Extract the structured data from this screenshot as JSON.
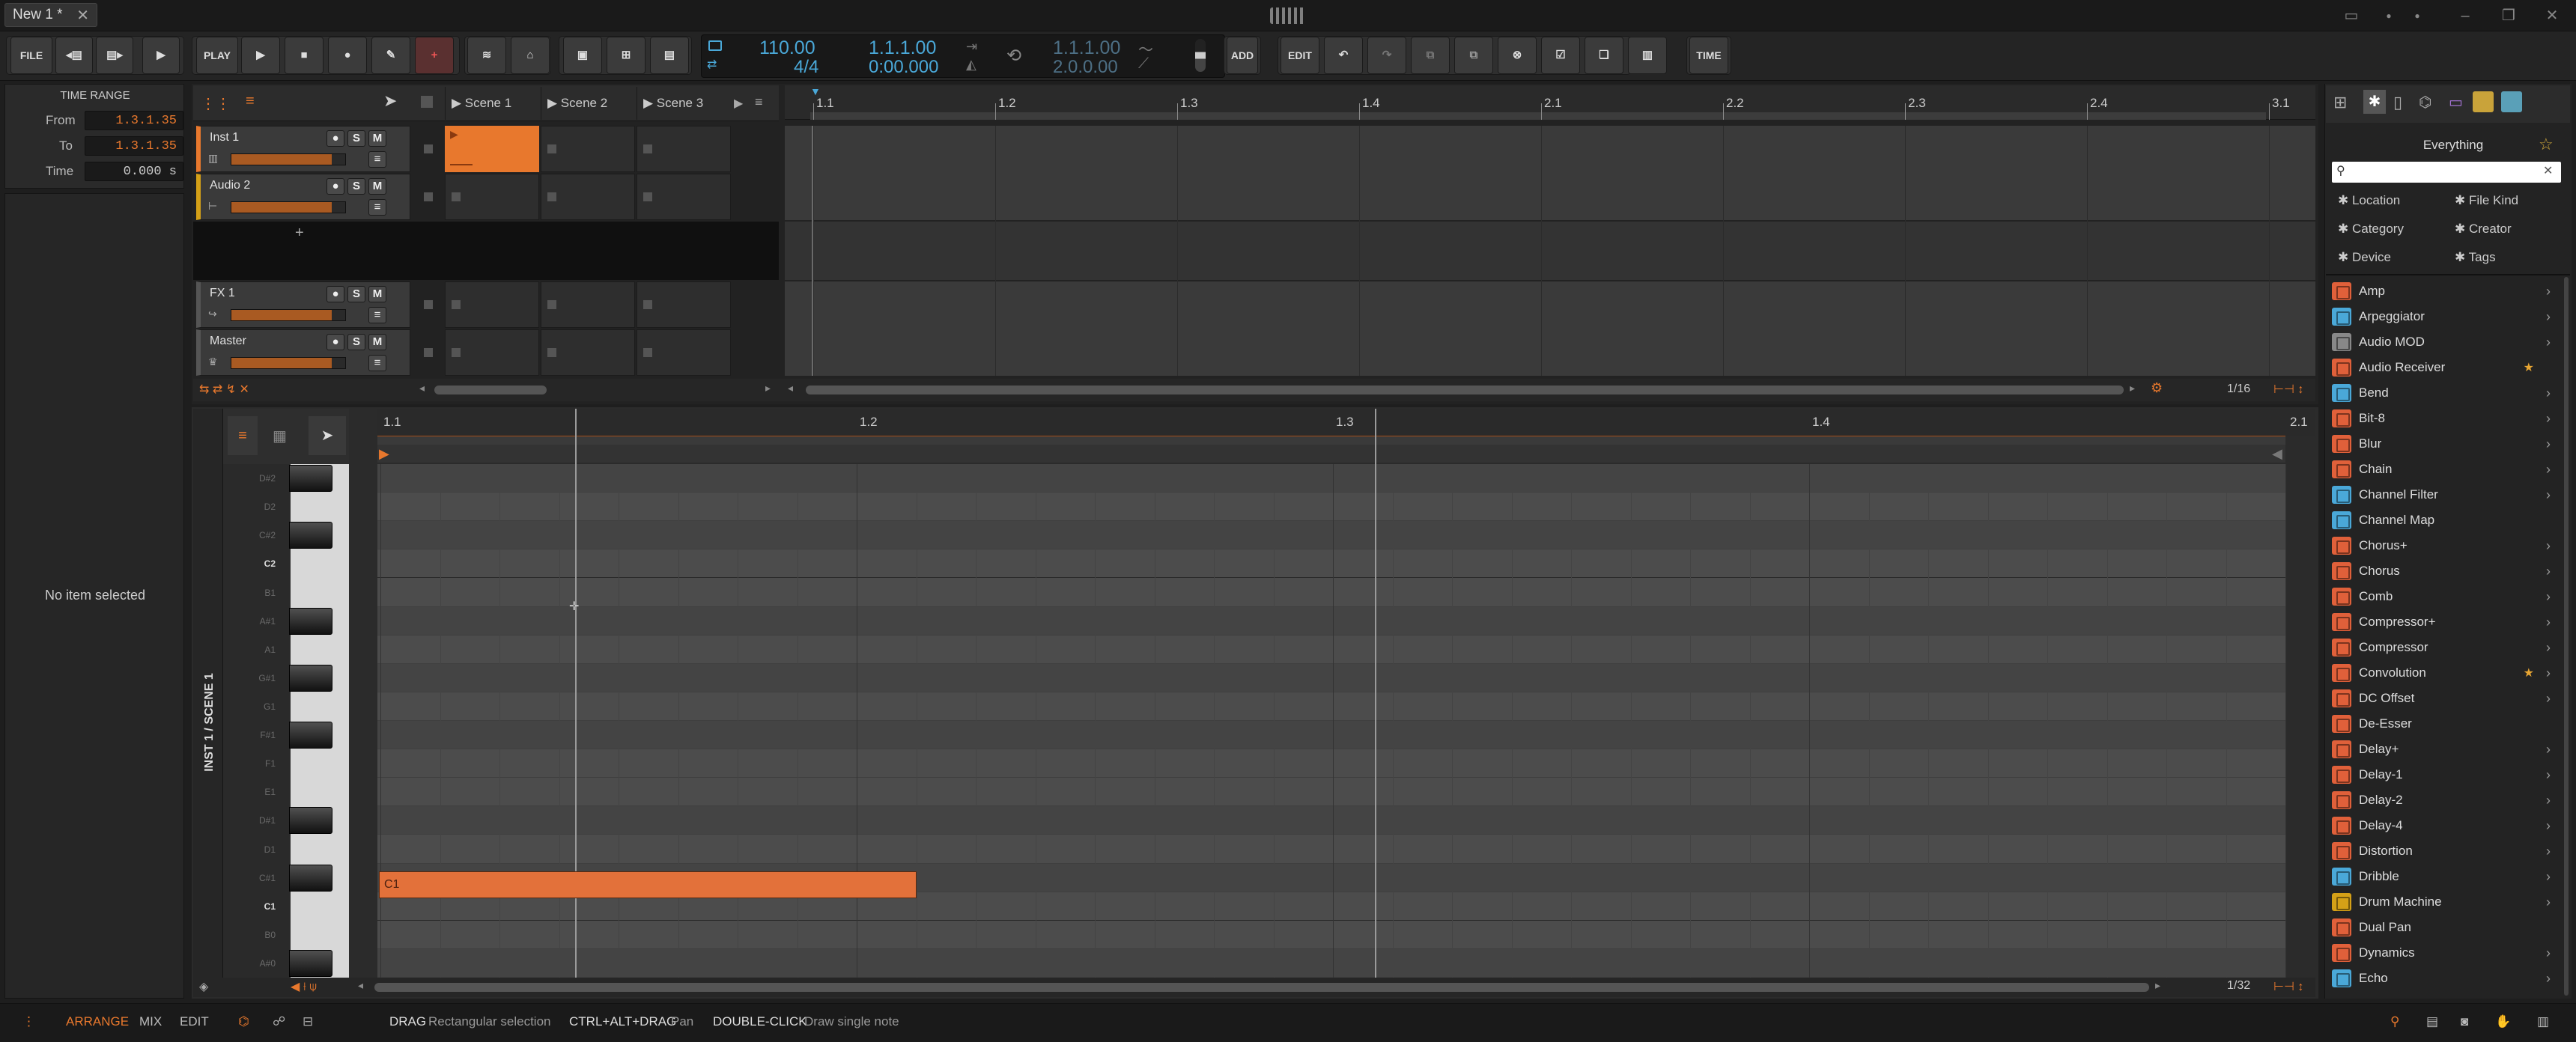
{
  "window": {
    "tab_title": "New 1 *",
    "close_glyph": "✕"
  },
  "toolbar": {
    "file": "FILE",
    "play_label": "PLAY",
    "add": "ADD",
    "edit": "EDIT",
    "time": "TIME",
    "tempo": "110.00",
    "time_signature": "4/4",
    "position_bars": "1.1.1.00",
    "position_time": "0:00.000",
    "loop_start": "1.1.1.00",
    "loop_length": "2.0.0.00"
  },
  "inspector": {
    "header": "TIME RANGE",
    "from_label": "From",
    "from_value": "1.3.1.35",
    "to_label": "To",
    "to_value": "1.3.1.35",
    "time_label": "Time",
    "time_value": "0.000 s",
    "empty_message": "No item selected"
  },
  "arranger": {
    "scenes": [
      "Scene 1",
      "Scene 2",
      "Scene 3"
    ],
    "tracks": [
      {
        "name": "Inst 1",
        "color": "#e8782d"
      },
      {
        "name": "Audio 2",
        "color": "#d4a017"
      },
      {
        "name": "FX 1",
        "color": "#555555"
      },
      {
        "name": "Master",
        "color": "#555555"
      }
    ],
    "mute": "M",
    "solo": "S",
    "add_track": "+",
    "ruler": [
      "1.1",
      "1.2",
      "1.3",
      "1.4",
      "2.1",
      "2.2",
      "2.3",
      "2.4",
      "3.1"
    ],
    "grid": "1/16"
  },
  "editor": {
    "vertical_label": "INST 1 / SCENE 1",
    "ruler": [
      "1.1",
      "1.2",
      "1.3",
      "1.4",
      "2.1"
    ],
    "keys": [
      "D#2",
      "D2",
      "C#2",
      "C2",
      "B1",
      "A#1",
      "A1",
      "G#1",
      "G1",
      "F#1",
      "F1",
      "E1",
      "D#1",
      "D1",
      "C#1",
      "C1",
      "B0",
      "A#0"
    ],
    "note_label": "C1",
    "note": {
      "pitch": "C1",
      "start": "1.1",
      "length_bars": 0.28
    },
    "grid": "1/32"
  },
  "browser": {
    "title": "Everything",
    "filters": [
      "Location",
      "File Kind",
      "Category",
      "Creator",
      "Device",
      "Tags"
    ],
    "items": [
      {
        "name": "Amp",
        "color": "#e0603a",
        "arrow": true,
        "star": false
      },
      {
        "name": "Arpeggiator",
        "color": "#4aa8d8",
        "arrow": true,
        "star": false
      },
      {
        "name": "Audio MOD",
        "color": "#888888",
        "arrow": true,
        "star": false
      },
      {
        "name": "Audio Receiver",
        "color": "#e0603a",
        "arrow": false,
        "star": true
      },
      {
        "name": "Bend",
        "color": "#4aa8d8",
        "arrow": true,
        "star": false
      },
      {
        "name": "Bit-8",
        "color": "#e0603a",
        "arrow": true,
        "star": false
      },
      {
        "name": "Blur",
        "color": "#e0603a",
        "arrow": true,
        "star": false
      },
      {
        "name": "Chain",
        "color": "#e0603a",
        "arrow": true,
        "star": false
      },
      {
        "name": "Channel Filter",
        "color": "#4aa8d8",
        "arrow": true,
        "star": false
      },
      {
        "name": "Channel Map",
        "color": "#4aa8d8",
        "arrow": false,
        "star": false
      },
      {
        "name": "Chorus+",
        "color": "#e0603a",
        "arrow": true,
        "star": false
      },
      {
        "name": "Chorus",
        "color": "#e0603a",
        "arrow": true,
        "star": false
      },
      {
        "name": "Comb",
        "color": "#e0603a",
        "arrow": true,
        "star": false
      },
      {
        "name": "Compressor+",
        "color": "#e0603a",
        "arrow": true,
        "star": false
      },
      {
        "name": "Compressor",
        "color": "#e0603a",
        "arrow": true,
        "star": false
      },
      {
        "name": "Convolution",
        "color": "#e0603a",
        "arrow": true,
        "star": true
      },
      {
        "name": "DC Offset",
        "color": "#e0603a",
        "arrow": true,
        "star": false
      },
      {
        "name": "De-Esser",
        "color": "#e0603a",
        "arrow": false,
        "star": false
      },
      {
        "name": "Delay+",
        "color": "#e0603a",
        "arrow": true,
        "star": false
      },
      {
        "name": "Delay-1",
        "color": "#e0603a",
        "arrow": true,
        "star": false
      },
      {
        "name": "Delay-2",
        "color": "#e0603a",
        "arrow": true,
        "star": false
      },
      {
        "name": "Delay-4",
        "color": "#e0603a",
        "arrow": true,
        "star": false
      },
      {
        "name": "Distortion",
        "color": "#e0603a",
        "arrow": true,
        "star": false
      },
      {
        "name": "Dribble",
        "color": "#4aa8d8",
        "arrow": true,
        "star": false
      },
      {
        "name": "Drum Machine",
        "color": "#d4a017",
        "arrow": true,
        "star": false
      },
      {
        "name": "Dual Pan",
        "color": "#e0603a",
        "arrow": false,
        "star": false
      },
      {
        "name": "Dynamics",
        "color": "#e0603a",
        "arrow": true,
        "star": false
      },
      {
        "name": "Echo",
        "color": "#4aa8d8",
        "arrow": true,
        "star": false
      }
    ]
  },
  "status": {
    "arrange": "ARRANGE",
    "mix": "MIX",
    "edit": "EDIT",
    "hint1_key": "DRAG",
    "hint1_text": "Rectangular selection",
    "hint2_key": "CTRL+ALT+DRAG",
    "hint2_text": "Pan",
    "hint3_key": "DOUBLE-CLICK",
    "hint3_text": "Draw single note"
  },
  "colors": {
    "accent": "#e8782d",
    "blue": "#4aa8d8"
  }
}
